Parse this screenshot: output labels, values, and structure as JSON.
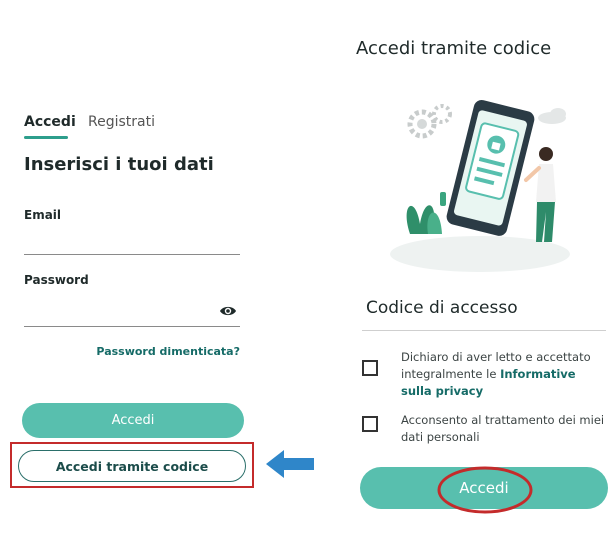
{
  "left": {
    "tabs": [
      {
        "label": "Accedi",
        "active": true
      },
      {
        "label": "Registrati",
        "active": false
      }
    ],
    "section_title": "Inserisci i tuoi dati",
    "email": {
      "label": "Email",
      "value": ""
    },
    "password": {
      "label": "Password",
      "value": ""
    },
    "forgot_label": "Password dimenticata?",
    "login_button": "Accedi",
    "code_login_button": "Accedi tramite codice",
    "icons": {
      "password_toggle": "eye-icon",
      "pointer": "arrow-left-icon"
    }
  },
  "right": {
    "title": "Accedi tramite codice",
    "code_section_title": "Codice di accesso",
    "consents": [
      {
        "text_before": "Dichiaro di aver letto e accettato integralmente le ",
        "link": "Informative sulla privacy",
        "checked": false
      },
      {
        "text_before": "Acconsento al trattamento dei miei dati personali",
        "link": "",
        "checked": false
      }
    ],
    "login_button": "Accedi"
  },
  "colors": {
    "accent": "#58bfae",
    "accent_dark": "#156b67",
    "highlight": "#c42b2b",
    "arrow": "#2f86c9"
  }
}
